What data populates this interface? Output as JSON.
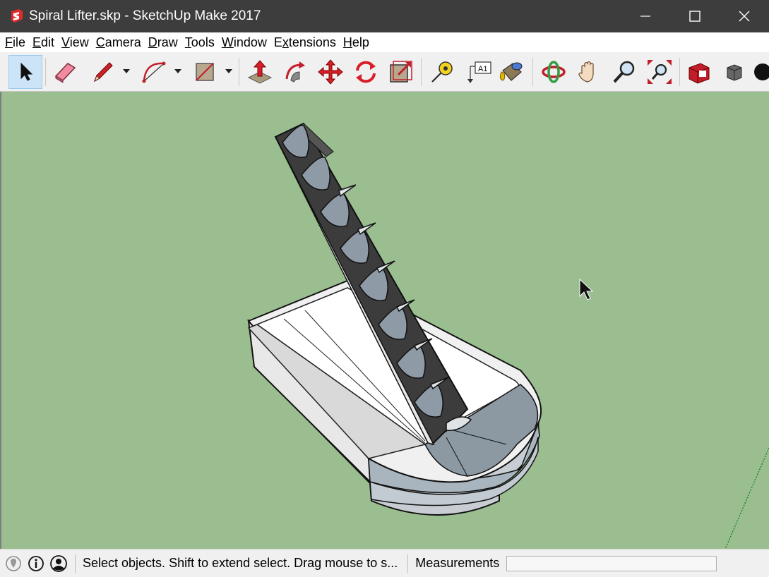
{
  "window": {
    "title": "Spiral Lifter.skp - SketchUp Make 2017",
    "app_icon": "sketchup-logo-icon",
    "controls": [
      "minimize-icon",
      "maximize-icon",
      "close-icon"
    ]
  },
  "menubar": {
    "items": [
      {
        "label": "File",
        "accel": "F"
      },
      {
        "label": "Edit",
        "accel": "E"
      },
      {
        "label": "View",
        "accel": "V"
      },
      {
        "label": "Camera",
        "accel": "C"
      },
      {
        "label": "Draw",
        "accel": "D"
      },
      {
        "label": "Tools",
        "accel": "T"
      },
      {
        "label": "Window",
        "accel": "W"
      },
      {
        "label": "Extensions",
        "accel": "x"
      },
      {
        "label": "Help",
        "accel": "H"
      }
    ]
  },
  "toolbar": {
    "tools": [
      "select-icon",
      "eraser-icon",
      "pencil-line-icon",
      "arc-icon",
      "rectangle-icon",
      "push-pull-icon",
      "follow-me-icon",
      "move-icon",
      "rotate-icon",
      "scale-icon",
      "tape-measure-icon",
      "text-icon",
      "paint-bucket-icon",
      "orbit-icon",
      "pan-icon",
      "zoom-icon",
      "zoom-extents-icon",
      "warehouse-icon",
      "extension-warehouse-icon",
      "style-icon"
    ],
    "text_tool_label": "A1",
    "active_tool": "select-icon"
  },
  "viewport": {
    "background_color": "#9bbe90",
    "model": "spiral lifter"
  },
  "statusbar": {
    "icons": [
      "geo-location-icon",
      "info-icon",
      "user-account-icon"
    ],
    "hint": "Select objects. Shift to extend select. Drag mouse to s...",
    "measurements_label": "Measurements",
    "measurements_value": ""
  }
}
